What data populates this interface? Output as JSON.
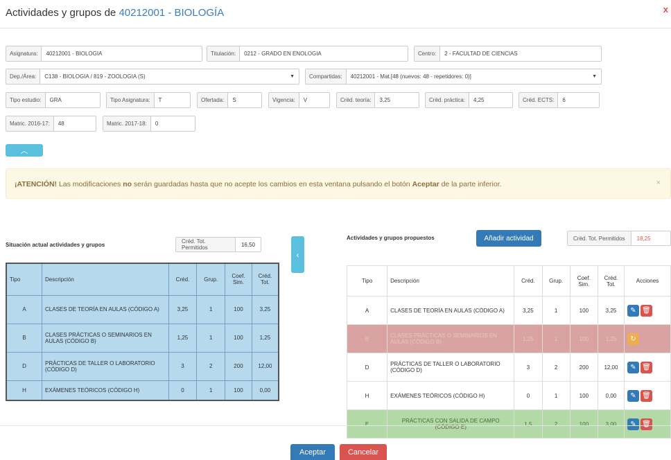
{
  "header": {
    "title_prefix": "Actividades y grupos de",
    "title_code": "40212001 - BIOLOGÍA",
    "close_glyph": "x"
  },
  "fields": {
    "asignatura": {
      "label": "Asignatura:",
      "value": "40212001 - BIOLOGIA"
    },
    "titulacion": {
      "label": "Titulación:",
      "value": "0212 - GRADO EN ENOLOGIA"
    },
    "centro": {
      "label": "Centro:",
      "value": "2 - FACULTAD DE CIENCIAS"
    },
    "dep_area": {
      "label": "Dep./Área:",
      "value": "C138 - BIOLOGIA / 819 - ZOOLOGIA (S)"
    },
    "compartidas": {
      "label": "Compartidas:",
      "value": "40212001 - Mat.[48 (nuevos: 48 - repetidores: 0)]"
    },
    "tipo_estudio": {
      "label": "Tipo estudio:",
      "value": "GRA"
    },
    "tipo_asignatura": {
      "label": "Tipo Asignatura:",
      "value": "T"
    },
    "ofertada": {
      "label": "Ofertada:",
      "value": "S"
    },
    "vigencia": {
      "label": "Vigencia:",
      "value": "V"
    },
    "cred_teoria": {
      "label": "Créd. teoría:",
      "value": "3,25"
    },
    "cred_practica": {
      "label": "Créd. práctica:",
      "value": "4,25"
    },
    "cred_ects": {
      "label": "Créd. ECTS:",
      "value": "6"
    },
    "matric_2016": {
      "label": "Matric. 2016-17:",
      "value": "48"
    },
    "matric_2017": {
      "label": "Matric. 2017-18:",
      "value": "0"
    }
  },
  "alert": {
    "strong": "¡ATENCIÓN!",
    "text1": " Las modificaciones ",
    "no": "no",
    "text2": " serán guardadas hasta que no acepte los cambios en esta ventana pulsando el botón ",
    "aceptar": "Aceptar",
    "text3": " de la parte inferior.",
    "dismiss": "×"
  },
  "left": {
    "title": "Situación actual actividades y grupos",
    "cred_label": "Créd. Tot. Permitidos",
    "cred_value": "16,50",
    "headers": [
      "Tipo",
      "Descripción",
      "Créd.",
      "Grup.",
      "Coef. Sim.",
      "Créd. Tot."
    ],
    "rows": [
      [
        "A",
        "CLASES DE TEORÍA EN AULAS (CÓDIGO A)",
        "3,25",
        "1",
        "100",
        "3,25"
      ],
      [
        "B",
        "CLASES PRÁCTICAS O SEMINARIOS EN AULAS (CÓDIGO B)",
        "1,25",
        "1",
        "100",
        "1,25"
      ],
      [
        "D",
        "PRÁCTICAS DE TALLER O LABORATORIO (CÓDIGO D)",
        "3",
        "2",
        "200",
        "12,00"
      ],
      [
        "H",
        "EXÁMENES TEÓRICOS (CÓDIGO H)",
        "0",
        "1",
        "100",
        "0,00"
      ]
    ]
  },
  "right": {
    "title": "Actividades y grupos propuestos",
    "add_label": "Añadir actividad",
    "cred_label": "Créd. Tot. Permitidos",
    "cred_value": "18,25",
    "headers": [
      "Tipo",
      "Descripción",
      "Créd.",
      "Grup.",
      "Coef. Sim.",
      "Créd. Tot.",
      "Acciones"
    ],
    "rows": [
      [
        "A",
        "CLASES DE TEORÍA EN AULAS (CÓDIGO A)",
        "3,25",
        "1",
        "100",
        "3,25"
      ],
      [
        "B",
        "CLASES PRÁCTICAS O SEMINARIOS EN AULAS (CÓDIGO B)",
        "1,25",
        "1",
        "100",
        "1,25"
      ],
      [
        "D",
        "PRÁCTICAS DE TALLER O LABORATORIO (CÓDIGO D)",
        "3",
        "2",
        "200",
        "12,00"
      ],
      [
        "H",
        "EXÁMENES TEÓRICOS (CÓDIGO H)",
        "0",
        "1",
        "100",
        "0,00"
      ],
      [
        "E",
        "PRÁCTICAS CON SALIDA DE CAMPO (CÓDIGO E)",
        "1,5",
        "2",
        "100",
        "3,00"
      ]
    ]
  },
  "footer": {
    "accept": "Aceptar",
    "cancel": "Cancelar"
  },
  "colors": {
    "accent": "#337ab7",
    "info": "#5bc0de",
    "danger": "#d9534f",
    "warning": "#f0ad4e",
    "deleted_row": "#d9a3a1",
    "added_row": "#b3d9a7"
  }
}
